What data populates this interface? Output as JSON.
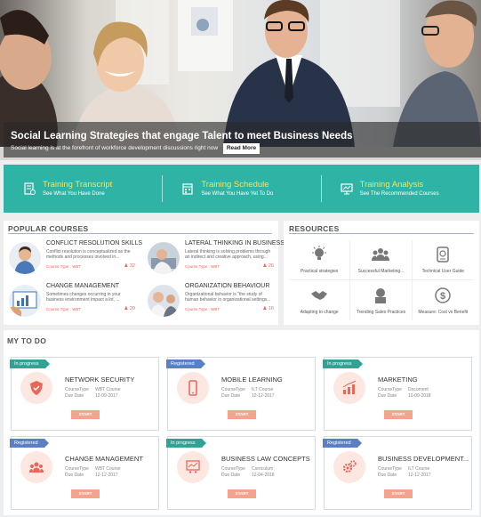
{
  "hero": {
    "title": "Social Learning Strategies that engage Talent to meet Business Needs",
    "subtitle": "Social learning is at the forefront of workforce development discussions right now",
    "read_more": "Read More"
  },
  "quick_links": [
    {
      "title": "Training Transcript",
      "subtitle": "See What You Have Done",
      "icon": "transcript-icon"
    },
    {
      "title": "Training Schedule",
      "subtitle": "See What You Have Yet To Do",
      "icon": "schedule-icon"
    },
    {
      "title": "Training Analysis",
      "subtitle": "See The Recommended Courses",
      "icon": "analysis-icon"
    }
  ],
  "popular": {
    "title": "POPULAR COURSES",
    "courses": [
      {
        "name": "CONFLICT RESOLUTION SKILLS",
        "desc": "Conflict resolution is conceptualized as the methods and processes involved in...",
        "type": "Course Type : WBT",
        "count": "32"
      },
      {
        "name": "LATERAL THINKING IN BUSINESS",
        "desc": "Lateral thinking is solving problems through an indirect and creative approach, using...",
        "type": "Course Type : WBT",
        "count": "26"
      },
      {
        "name": "CHANGE MANAGEMENT",
        "desc": "Sometimes changes occurring in your business environment impact a lot, ...",
        "type": "Course Type : WBT",
        "count": "20"
      },
      {
        "name": "ORGANIZATION BEHAVIOUR",
        "desc": "Organizational behavior is \"the study of human behavior in organizational settings...",
        "type": "Course Type : WBT",
        "count": "16"
      }
    ]
  },
  "resources": {
    "title": "RESOURCES",
    "items": [
      {
        "label": "Practical strategies",
        "icon": "lightbulb-icon"
      },
      {
        "label": "Successful Marketing...",
        "icon": "group-icon"
      },
      {
        "label": "Technical User Guide",
        "icon": "guide-icon"
      },
      {
        "label": "Adapting to change",
        "icon": "handshake-icon"
      },
      {
        "label": "Trending Sales Practices",
        "icon": "presenter-icon"
      },
      {
        "label": "Measure: Cost vs Benefit",
        "icon": "dollar-icon"
      }
    ]
  },
  "todo": {
    "title": "MY TO DO",
    "type_label": "CourseType",
    "due_label": "Due Date",
    "start_label": "START",
    "cards": [
      {
        "status": "In progress",
        "status_color": "#2fa396",
        "title": "NETWORK SECURITY",
        "type": "WBT Course",
        "due": "12-09-2017",
        "icon": "shield-icon"
      },
      {
        "status": "Registered",
        "status_color": "#5b7fc7",
        "title": "MOBILE LEARNING",
        "type": "ILT Course",
        "due": "12-12-2017",
        "icon": "mobile-icon"
      },
      {
        "status": "In progress",
        "status_color": "#2fa396",
        "title": "MARKETING",
        "type": "Document",
        "due": "10-09-2018",
        "icon": "chart-icon"
      },
      {
        "status": "Registered",
        "status_color": "#5b7fc7",
        "title": "CHANGE MANAGEMENT",
        "type": "WBT Course",
        "due": "12-12-2017",
        "icon": "team-icon"
      },
      {
        "status": "In progress",
        "status_color": "#2fa396",
        "title": "BUSINESS LAW CONCEPTS",
        "type": "Curriculum",
        "due": "12-04-2018",
        "icon": "presentation-icon"
      },
      {
        "status": "Registered",
        "status_color": "#5b7fc7",
        "title": "BUSINESS DEVELOPMENT...",
        "type": "ILT Course",
        "due": "12-12-2017",
        "icon": "gears-icon"
      }
    ]
  }
}
